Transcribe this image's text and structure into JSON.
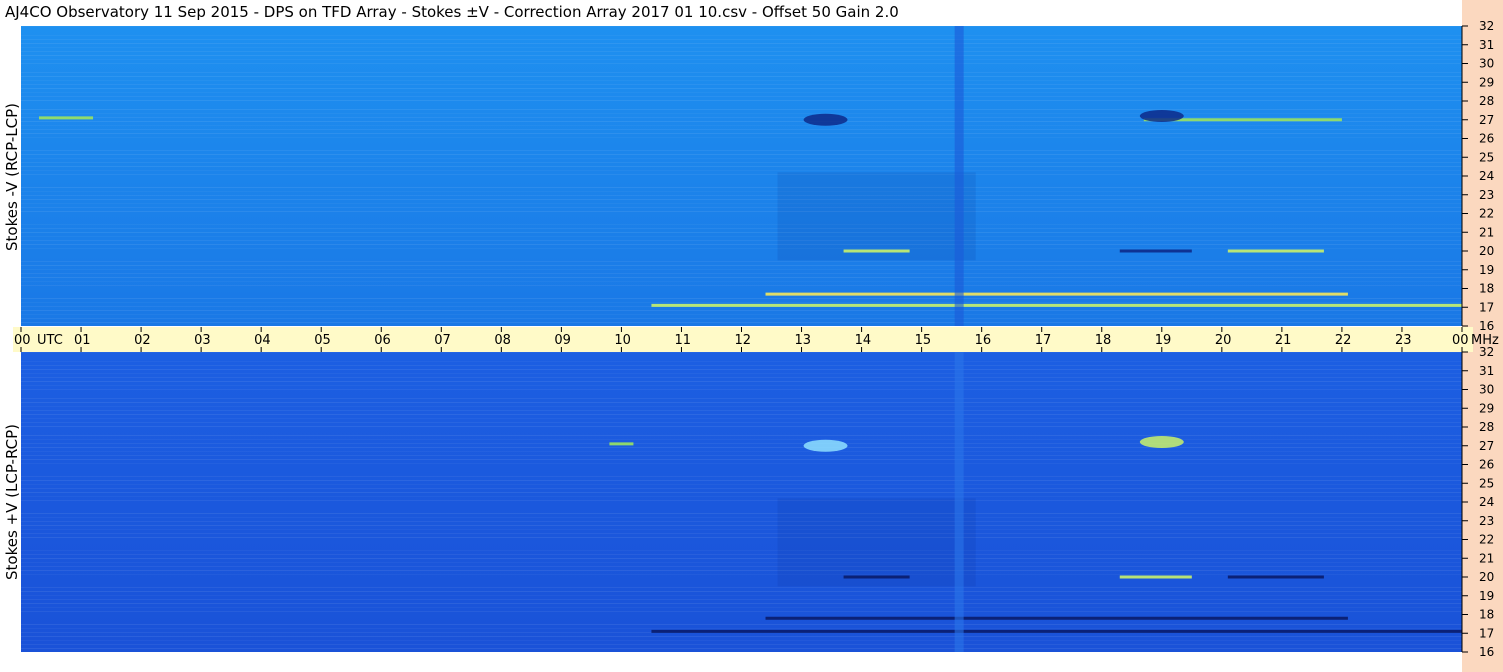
{
  "title": "AJ4CO Observatory  11 Sep 2015  -  DPS on TFD Array  -  Stokes ±V  -  Correction Array 2017 01 10.csv  -  Offset 50  Gain 2.0",
  "colors": {
    "top_background": "#1a86ee",
    "bottom_background": "#1c58dc",
    "time_bar": "#fffac8",
    "right_strip": "#fbd8bf"
  },
  "chart_data": [
    {
      "type": "heatmap",
      "ylabel": "Stokes -V (RCP-LCP)",
      "x_unit": "UTC",
      "y_unit": "MHz",
      "xlim": [
        0,
        24
      ],
      "ylim": [
        16,
        32
      ],
      "x_ticks": [
        "00",
        "01",
        "02",
        "03",
        "04",
        "05",
        "06",
        "07",
        "08",
        "09",
        "10",
        "11",
        "12",
        "13",
        "14",
        "15",
        "16",
        "17",
        "18",
        "19",
        "20",
        "21",
        "22",
        "23",
        "00"
      ],
      "y_ticks": [
        "16",
        "17",
        "18",
        "19",
        "20",
        "21",
        "22",
        "23",
        "24",
        "25",
        "26",
        "27",
        "28",
        "29",
        "30",
        "31",
        "32"
      ],
      "features": [
        {
          "kind": "band",
          "freq": 17.7,
          "t_start": 12.4,
          "t_end": 22.1,
          "color": "#f5e85a"
        },
        {
          "kind": "band",
          "freq": 17.1,
          "t_start": 10.5,
          "t_end": 24.0,
          "color": "#c9f26a"
        },
        {
          "kind": "band",
          "freq": 20.0,
          "t_start": 18.3,
          "t_end": 19.5,
          "color": "#0d2a8a"
        },
        {
          "kind": "band",
          "freq": 20.0,
          "t_start": 20.1,
          "t_end": 21.7,
          "color": "#c9f26a"
        },
        {
          "kind": "band",
          "freq": 20.0,
          "t_start": 13.7,
          "t_end": 14.8,
          "color": "#c9f26a"
        },
        {
          "kind": "band",
          "freq": 27.1,
          "t_start": 0.3,
          "t_end": 1.2,
          "color": "#9be35f"
        },
        {
          "kind": "band",
          "freq": 27.0,
          "t_start": 18.7,
          "t_end": 22.0,
          "color": "#9be35f"
        },
        {
          "kind": "blob",
          "freq": 27.0,
          "time": 13.4,
          "color": "#0d2a8a"
        },
        {
          "kind": "blob",
          "freq": 27.2,
          "time": 19.0,
          "color": "#0d2a8a"
        },
        {
          "kind": "column",
          "t_start": 15.55,
          "t_end": 15.7,
          "color": "#1a5ad8"
        }
      ]
    },
    {
      "type": "heatmap",
      "ylabel": "Stokes +V (LCP-RCP)",
      "x_unit": "UTC",
      "y_unit": "MHz",
      "xlim": [
        0,
        24
      ],
      "ylim": [
        16,
        32
      ],
      "x_ticks": [
        "00",
        "01",
        "02",
        "03",
        "04",
        "05",
        "06",
        "07",
        "08",
        "09",
        "10",
        "11",
        "12",
        "13",
        "14",
        "15",
        "16",
        "17",
        "18",
        "19",
        "20",
        "21",
        "22",
        "23",
        "00"
      ],
      "y_ticks": [
        "16",
        "17",
        "18",
        "19",
        "20",
        "21",
        "22",
        "23",
        "24",
        "25",
        "26",
        "27",
        "28",
        "29",
        "30",
        "31",
        "32"
      ],
      "features": [
        {
          "kind": "band",
          "freq": 17.8,
          "t_start": 12.4,
          "t_end": 22.1,
          "color": "#0a1c6a"
        },
        {
          "kind": "band",
          "freq": 17.1,
          "t_start": 10.5,
          "t_end": 24.0,
          "color": "#0a1c6a"
        },
        {
          "kind": "band",
          "freq": 20.0,
          "t_start": 18.3,
          "t_end": 19.5,
          "color": "#c9f26a"
        },
        {
          "kind": "band",
          "freq": 20.0,
          "t_start": 20.1,
          "t_end": 21.7,
          "color": "#0a1c6a"
        },
        {
          "kind": "band",
          "freq": 20.0,
          "t_start": 13.7,
          "t_end": 14.8,
          "color": "#0a1c6a"
        },
        {
          "kind": "band",
          "freq": 27.1,
          "t_start": 9.8,
          "t_end": 10.2,
          "color": "#9be35f"
        },
        {
          "kind": "blob",
          "freq": 27.0,
          "time": 13.4,
          "color": "#8fe0ff"
        },
        {
          "kind": "blob",
          "freq": 27.2,
          "time": 19.0,
          "color": "#c9f26a"
        },
        {
          "kind": "column",
          "t_start": 15.55,
          "t_end": 15.7,
          "color": "#2a74ea"
        }
      ]
    }
  ]
}
